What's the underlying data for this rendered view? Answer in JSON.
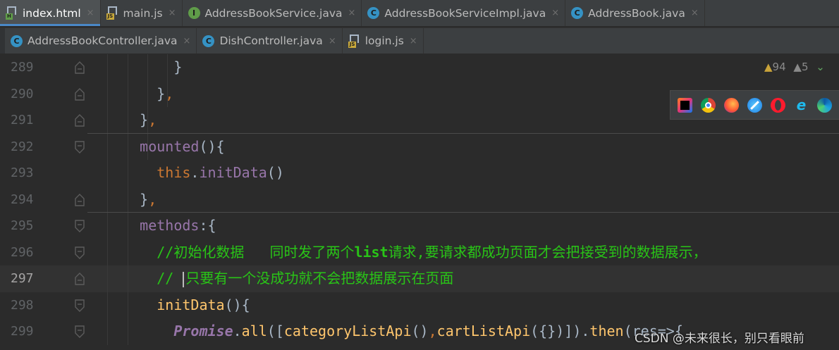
{
  "tabs_row1": [
    {
      "label": "index.html",
      "icon": "html-file-icon",
      "active": true
    },
    {
      "label": "main.js",
      "icon": "js-file-icon",
      "active": false
    },
    {
      "label": "AddressBookService.java",
      "icon": "interface-icon",
      "active": false
    },
    {
      "label": "AddressBookServiceImpl.java",
      "icon": "class-icon",
      "active": false
    },
    {
      "label": "AddressBook.java",
      "icon": "class-icon",
      "active": false
    }
  ],
  "tabs_row2": [
    {
      "label": "AddressBookController.java",
      "icon": "class-icon",
      "active": false
    },
    {
      "label": "DishController.java",
      "icon": "class-icon",
      "active": false
    },
    {
      "label": "login.js",
      "icon": "js-file-icon",
      "active": false
    }
  ],
  "tab_close_glyph": "×",
  "inspections": {
    "warnings": "94",
    "weak_warnings": "5"
  },
  "browsers": [
    "intellij-icon",
    "chrome-icon",
    "firefox-icon",
    "safari-icon",
    "opera-icon",
    "ie-icon",
    "edge-icon"
  ],
  "editor": {
    "current_line": "297",
    "lines": [
      {
        "num": "289",
        "tokens": [
          {
            "t": "        }",
            "c": "plain"
          }
        ]
      },
      {
        "num": "290",
        "tokens": [
          {
            "t": "      }",
            "c": "plain"
          },
          {
            "t": ",",
            "c": "punc"
          }
        ]
      },
      {
        "num": "291",
        "tokens": [
          {
            "t": "    }",
            "c": "plain"
          },
          {
            "t": ",",
            "c": "punc"
          }
        ]
      },
      {
        "num": "292",
        "tokens": [
          {
            "t": "    mounted",
            "c": "prop"
          },
          {
            "t": "(){",
            "c": "plain"
          }
        ]
      },
      {
        "num": "293",
        "tokens": [
          {
            "t": "      ",
            "c": "plain"
          },
          {
            "t": "this",
            "c": "this"
          },
          {
            "t": ".",
            "c": "plain"
          },
          {
            "t": "initData",
            "c": "prop"
          },
          {
            "t": "()",
            "c": "plain"
          }
        ]
      },
      {
        "num": "294",
        "tokens": [
          {
            "t": "    }",
            "c": "plain"
          },
          {
            "t": ",",
            "c": "punc"
          }
        ]
      },
      {
        "num": "295",
        "tokens": [
          {
            "t": "    methods",
            "c": "prop"
          },
          {
            "t": ":{",
            "c": "plain"
          }
        ]
      },
      {
        "num": "296",
        "tokens": [
          {
            "t": "      //初始化数据   同时发了两个",
            "c": "cmt"
          },
          {
            "t": "list",
            "c": "cmtb"
          },
          {
            "t": "请求,要请求都成功页面才会把接受到的数据展示，",
            "c": "cmt"
          }
        ]
      },
      {
        "num": "297",
        "tokens": [
          {
            "t": "      // ",
            "c": "cmt"
          },
          {
            "t": "",
            "c": "caret"
          },
          {
            "t": "只要有一个没成功就不会把数据展示在页面",
            "c": "cmt"
          }
        ]
      },
      {
        "num": "298",
        "tokens": [
          {
            "t": "      initData",
            "c": "fn"
          },
          {
            "t": "(){",
            "c": "plain"
          }
        ]
      },
      {
        "num": "299",
        "tokens": [
          {
            "t": "        ",
            "c": "plain"
          },
          {
            "t": "Promise",
            "c": "it"
          },
          {
            "t": ".",
            "c": "plain"
          },
          {
            "t": "all",
            "c": "fn"
          },
          {
            "t": "([",
            "c": "plain"
          },
          {
            "t": "categoryListApi",
            "c": "fn"
          },
          {
            "t": "()",
            "c": "plain"
          },
          {
            "t": ",",
            "c": "punc"
          },
          {
            "t": "cartListApi",
            "c": "fn"
          },
          {
            "t": "({})]).",
            "c": "plain"
          },
          {
            "t": "then",
            "c": "fn"
          },
          {
            "t": "(res=>{",
            "c": "plain"
          }
        ]
      }
    ]
  },
  "watermark": "CSDN @未来很长，别只看眼前"
}
